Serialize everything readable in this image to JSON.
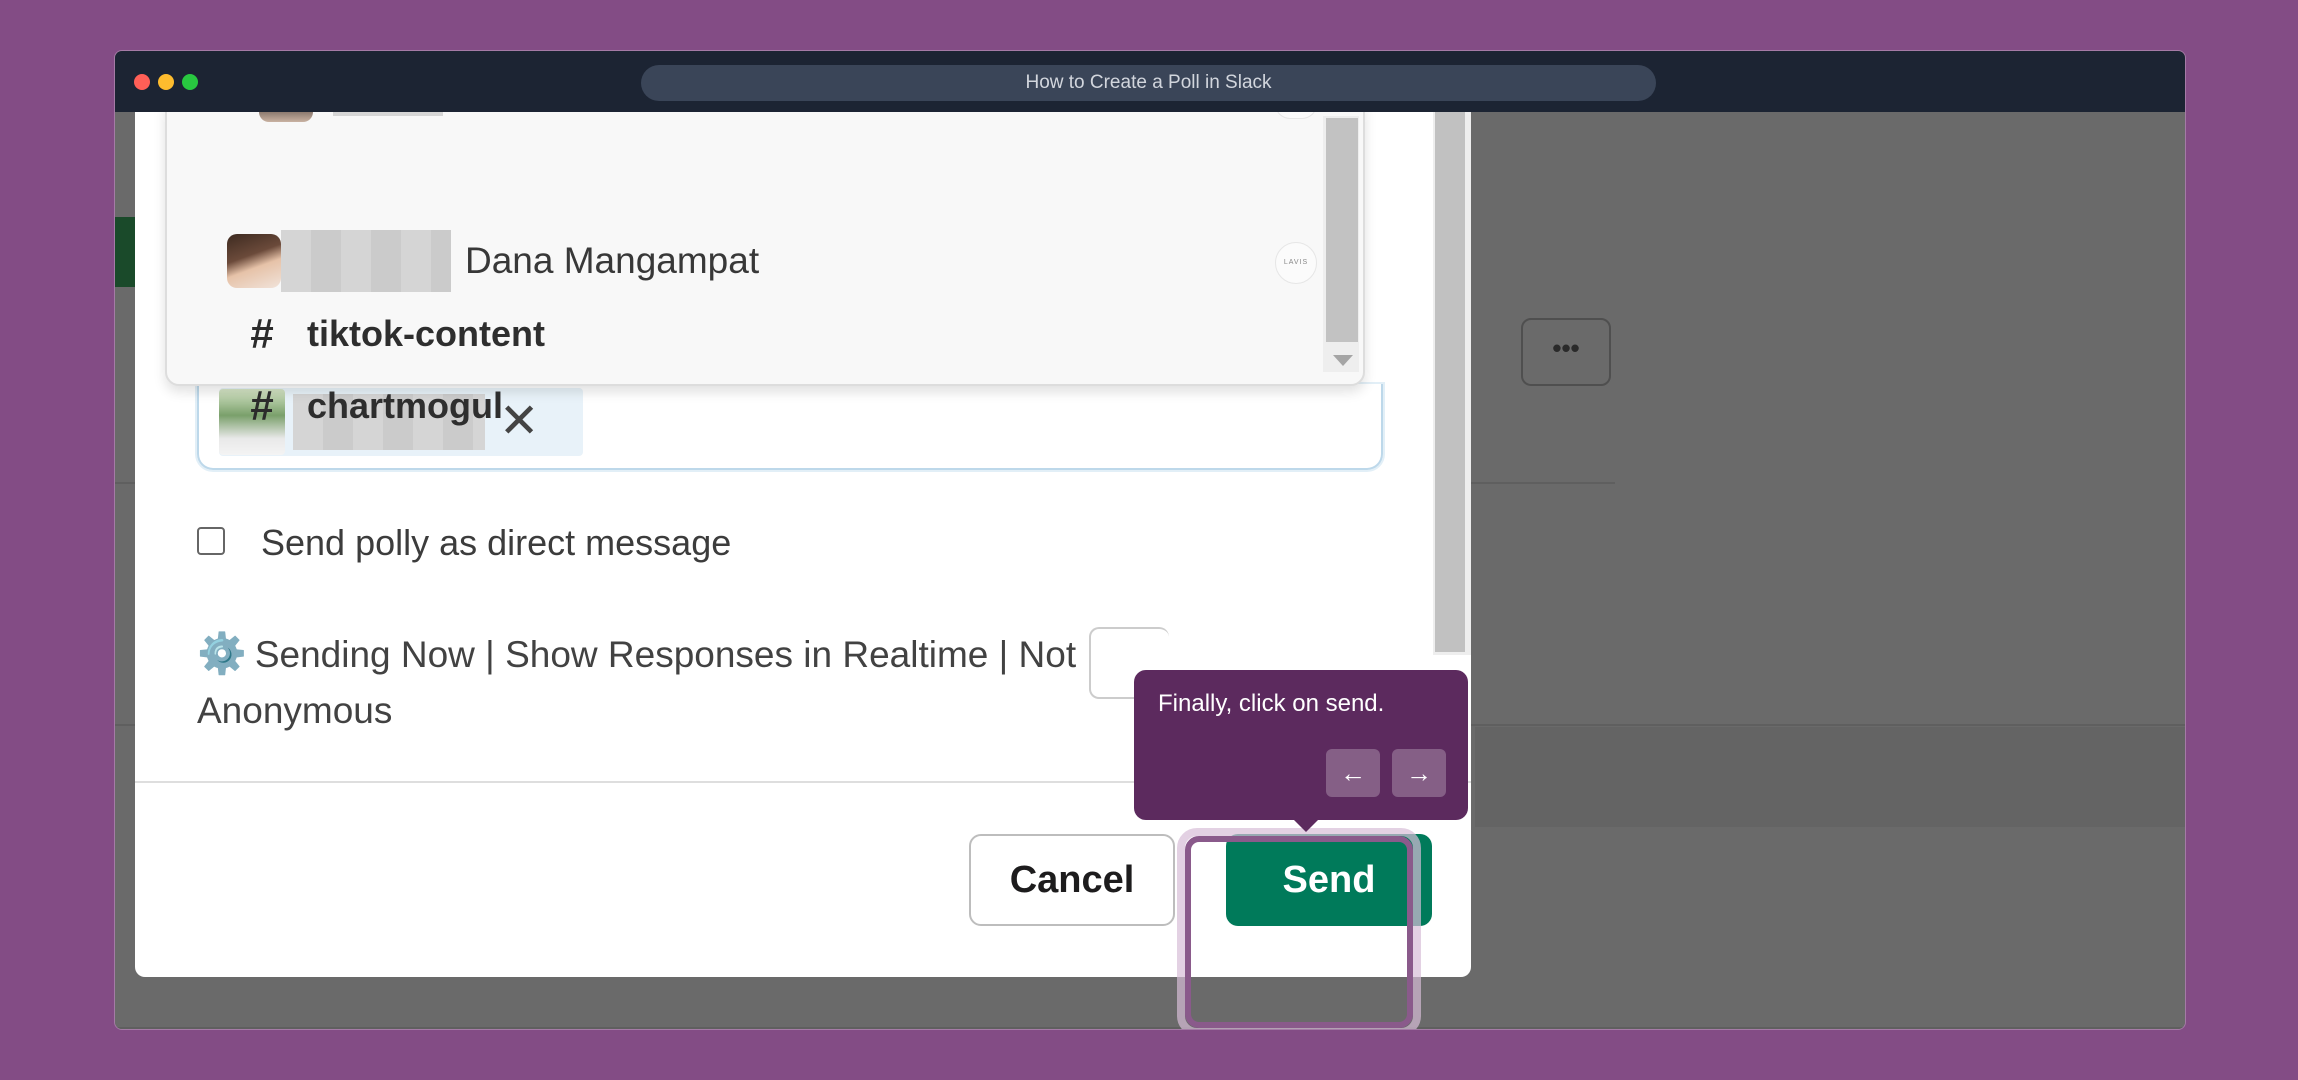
{
  "window": {
    "title": "How to Create a Poll in Slack"
  },
  "background": {
    "more_label": "•••"
  },
  "dropdown": {
    "person": {
      "name": "Dana Mangampat",
      "badge": "LAVIS"
    },
    "channels": [
      {
        "hash": "#",
        "name": "tiktok-content"
      },
      {
        "hash": "#",
        "name": "chartmogul"
      }
    ]
  },
  "selected_chip": {
    "remove_glyph": "✕"
  },
  "dm_checkbox": {
    "label": "Send polly as direct message",
    "checked": false
  },
  "settings": {
    "gear": "⚙️",
    "text": "Sending Now | Show Responses in Realtime | Not Anonymous"
  },
  "footer": {
    "cancel_label": "Cancel",
    "send_label": "Send"
  },
  "tooltip": {
    "text": "Finally, click on send.",
    "prev": "←",
    "next": "→"
  }
}
